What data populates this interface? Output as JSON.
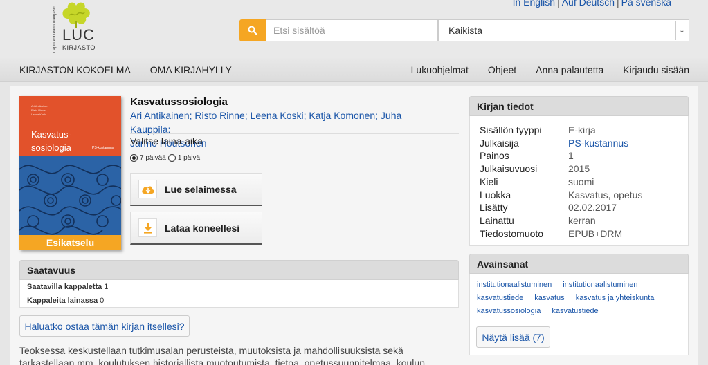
{
  "header": {
    "languages": [
      "In English",
      "Auf Deutsch",
      "På svenska"
    ],
    "logo": {
      "vertical_text": "Lapin korkeakoulukirjasto",
      "name": "LUC",
      "subtitle": "KIRJASTO"
    },
    "search": {
      "placeholder": "Etsi sisältöä",
      "scope": "Kaikista"
    }
  },
  "nav": {
    "left": [
      "KIRJASTON KOKOELMA",
      "OMA KIRJAHYLLY"
    ],
    "right": [
      "Lukuohjelmat",
      "Ohjeet",
      "Anna palautetta",
      "Kirjaudu sisään"
    ]
  },
  "book": {
    "title": "Kasvatussosiologia",
    "authors": [
      "Ari Antikainen",
      "Risto Rinne",
      "Leena Koski",
      "Katja Komonen",
      "Juha Kauppila",
      "Jarmo Houtsonen"
    ],
    "loan_label": "Valitse laina-aika",
    "loan_options": [
      "7 päivää",
      "1 päivä"
    ],
    "read_button": "Lue selaimessa",
    "download_button": "Lataa koneellesi",
    "cover": {
      "title_line1": "Kasvatus-",
      "title_line2": "sosiologia",
      "authors_text": "Ari Antikainen\nRisto Rinne\nLeena Koski",
      "publisher": "PS-kustannus",
      "preview_label": "Esikatselu",
      "colors": {
        "top": "#e2522b",
        "pattern": "#2b63a6",
        "preview": "#f5a623"
      }
    }
  },
  "availability": {
    "title": "Saatavuus",
    "rows": [
      {
        "label": "Saatavilla kappaletta",
        "value": "1"
      },
      {
        "label": "Kappaleita lainassa",
        "value": "0"
      }
    ],
    "buy_button": "Haluatko ostaa tämän kirjan itsellesi?"
  },
  "description": "Teoksessa keskustellaan tutkimusalan perusteista, muutoksista ja mahdollisuuksista sekä tarkastellaan mm. koulutuksen historiallista muotoutumista, tietoa, opetussuunnitelmaa, koulun tehtäviä ja käytäntöjä",
  "details": {
    "title": "Kirjan tiedot",
    "rows": [
      {
        "key": "Sisällön tyyppi",
        "value": "E-kirja"
      },
      {
        "key": "Julkaisija",
        "value": "PS-kustannus",
        "link": true
      },
      {
        "key": "Painos",
        "value": "1"
      },
      {
        "key": "Julkaisuvuosi",
        "value": "2015"
      },
      {
        "key": "Kieli",
        "value": "suomi"
      },
      {
        "key": "Luokka",
        "value": "Kasvatus, opetus"
      },
      {
        "key": "Lisätty",
        "value": "02.02.2017"
      },
      {
        "key": "Lainattu",
        "value": "kerran"
      },
      {
        "key": "Tiedostomuoto",
        "value": "EPUB+DRM"
      }
    ]
  },
  "keywords": {
    "title": "Avainsanat",
    "items": [
      "institutionaalistuminen",
      "institutionaalistuminen",
      "kasvatustiede",
      "kasvatus",
      "kasvatus ja yhteiskunta",
      "kasvatussosiologia",
      "kasvatustiede"
    ],
    "more_button": "Näytä lisää (7)"
  },
  "colors": {
    "accent": "#f5a623",
    "link": "#1a55a8"
  }
}
